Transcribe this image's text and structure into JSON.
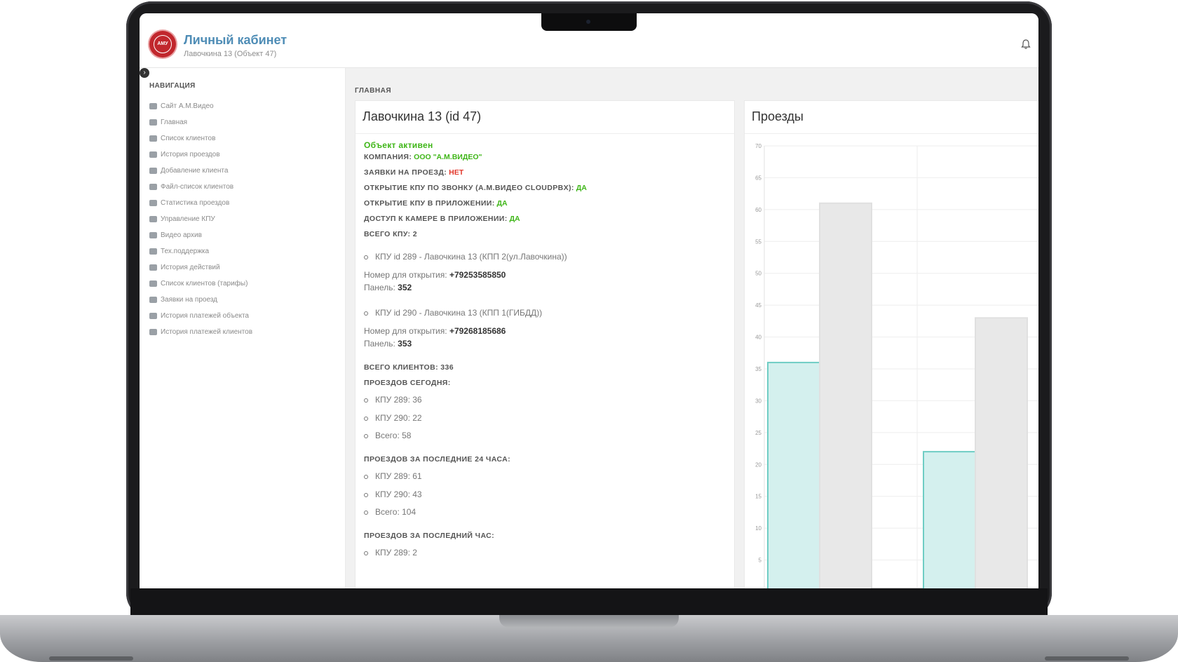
{
  "header": {
    "logo_text": "АМУ",
    "title": "Личный кабинет",
    "subtitle": "Лавочкина 13 (Объект 47)"
  },
  "sidebar": {
    "toggle_icon": "chevron-right-icon",
    "heading": "НАВИГАЦИЯ",
    "items": [
      {
        "label": "Сайт А.М.Видео",
        "icon": "globe-icon"
      },
      {
        "label": "Главная",
        "icon": "home-icon"
      },
      {
        "label": "Список клиентов",
        "icon": "user-icon"
      },
      {
        "label": "История проездов",
        "icon": "car-icon"
      },
      {
        "label": "Добавление клиента",
        "icon": "user-plus-icon"
      },
      {
        "label": "Файл-список клиентов",
        "icon": "list-icon"
      },
      {
        "label": "Статистика проездов",
        "icon": "bar-chart-icon"
      },
      {
        "label": "Управление КПУ",
        "icon": "video-camera-icon"
      },
      {
        "label": "Видео архив",
        "icon": "film-icon"
      },
      {
        "label": "Тех.поддержка",
        "icon": "support-icon"
      },
      {
        "label": "История действий",
        "icon": "calendar-icon"
      },
      {
        "label": "Список клиентов (тарифы)",
        "icon": "dollar-icon"
      },
      {
        "label": "Заявки на проезд",
        "icon": "book-icon"
      },
      {
        "label": "История платежей объекта",
        "icon": "credit-card-icon"
      },
      {
        "label": "История платежей клиентов",
        "icon": "credit-card-icon"
      }
    ]
  },
  "breadcrumb": "ГЛАВНАЯ",
  "main": {
    "title": "Лавочкина 13 (id 47)",
    "status": "Объект активен",
    "company_label": "КОМПАНИЯ:",
    "company_value": "ООО \"А.М.ВИДЕО\"",
    "requests_label": "ЗАЯВКИ НА ПРОЕЗД:",
    "requests_value": "НЕТ",
    "open_call_label": "ОТКРЫТИЕ КПУ ПО ЗВОНКУ (А.М.ВИДЕО CLOUDPBX):",
    "open_call_value": "ДА",
    "open_app_label": "ОТКРЫТИЕ КПУ В ПРИЛОЖЕНИИ:",
    "open_app_value": "ДА",
    "camera_label": "ДОСТУП К КАМЕРЕ В ПРИЛОЖЕНИИ:",
    "camera_value": "ДА",
    "total_kpu": "ВСЕГО КПУ: 2",
    "kpu": [
      {
        "title": "КПУ id 289 - Лавочкина 13 (КПП 2(ул.Лавочкина))",
        "phone_label": "Номер для открытия:",
        "phone": "+79253585850",
        "panel_label": "Панель:",
        "panel": "352"
      },
      {
        "title": "КПУ id 290 - Лавочкина 13 (КПП 1(ГИБДД))",
        "phone_label": "Номер для открытия:",
        "phone": "+79268185686",
        "panel_label": "Панель:",
        "panel": "353"
      }
    ],
    "total_clients": "ВСЕГО КЛИЕНТОВ: 336",
    "today_heading": "ПРОЕЗДОВ СЕГОДНЯ:",
    "today": [
      "КПУ 289: 36",
      "КПУ 290: 22",
      "Всего: 58"
    ],
    "day_heading": "ПРОЕЗДОВ ЗА ПОСЛЕДНИЕ 24 ЧАСА:",
    "day": [
      "КПУ 289: 61",
      "КПУ 290: 43",
      "Всего: 104"
    ],
    "hour_heading": "ПРОЕЗДОВ ЗА ПОСЛЕДНИЙ ЧАС:",
    "hour": [
      "КПУ 289: 2"
    ]
  },
  "chart_panel": {
    "title": "Проезды"
  },
  "chart_data": {
    "type": "bar",
    "ylim": [
      0,
      70
    ],
    "yticks": [
      5,
      10,
      15,
      20,
      25,
      30,
      35,
      40,
      45,
      50,
      55,
      60,
      65,
      70
    ],
    "grid": true,
    "bars": [
      {
        "value": 36,
        "color": "#d4f0ee",
        "stroke": "#6fcdc4"
      },
      {
        "value": 61,
        "color": "#e8e8e8",
        "stroke": "#e0e0e0"
      },
      {
        "value": 0.5,
        "color": "#cfcfcf",
        "stroke": "#bdbdbd"
      },
      {
        "value": 22,
        "color": "#d4f0ee",
        "stroke": "#6fcdc4"
      },
      {
        "value": 43,
        "color": "#e8e8e8",
        "stroke": "#e0e0e0"
      }
    ]
  },
  "colors": {
    "accent": "#4f8db6",
    "green": "#3fb618",
    "red": "#e2372b",
    "logo": "#c1272d"
  }
}
